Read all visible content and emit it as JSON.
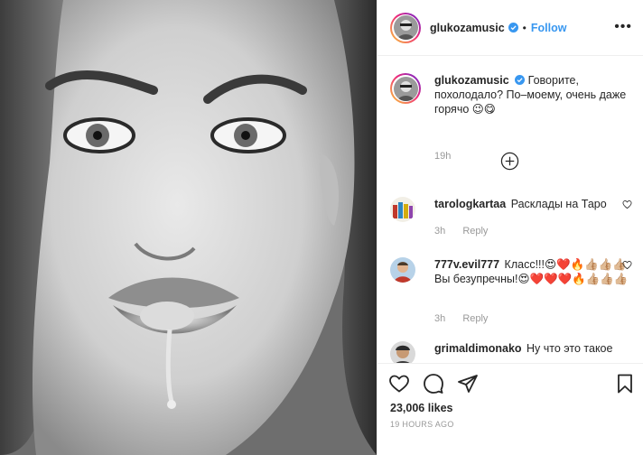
{
  "post": {
    "author": "glukozamusic",
    "follow_label": "Follow",
    "dot": "•",
    "more_label": "•••",
    "caption_text": "Говорите, похолодало? По–моему, очень даже горячо 😉😋",
    "caption_time": "19h",
    "likes": "23,006 likes",
    "posted_ago": "19 HOURS AGO"
  },
  "comments": [
    {
      "user": "tarologkartaa",
      "text": "Расклады на Таро",
      "time": "3h",
      "reply": "Reply"
    },
    {
      "user": "777v.evil777",
      "text": "Класс!!!😍❤️🔥👍🏼👍🏼👍🏼 Вы безупречны!😍❤️❤️❤️🔥👍🏼👍🏼👍🏼",
      "time": "3h",
      "reply": "Reply"
    },
    {
      "user": "grimaldimonako",
      "text": "Ну что это такое"
    }
  ],
  "icons": {
    "more": "more-icon",
    "verified": "verified-badge-icon",
    "load_more": "plus-circle-icon",
    "like": "heart-outline-icon",
    "comment": "comment-bubble-icon",
    "share": "paper-plane-icon",
    "save": "bookmark-icon"
  },
  "colors": {
    "link": "#3897f0",
    "text": "#262626",
    "muted": "#999999",
    "border": "#efefef"
  }
}
